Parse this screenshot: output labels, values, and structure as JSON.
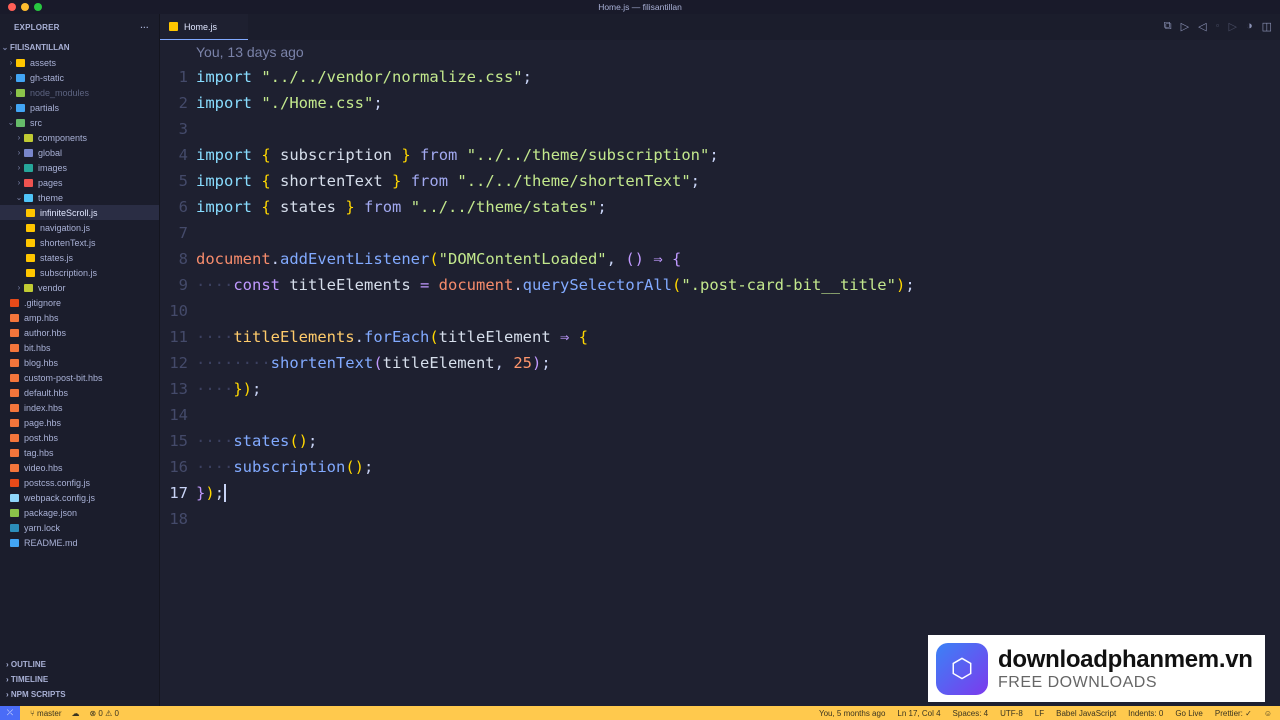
{
  "window": {
    "title": "Home.js — filisantillan"
  },
  "sidebar": {
    "title": "EXPLORER",
    "more": "···",
    "root": "FILISANTILLAN",
    "items": [
      {
        "label": "assets",
        "depth": 1,
        "type": "folder",
        "color": "#ffc600"
      },
      {
        "label": "gh-static",
        "depth": 1,
        "type": "folder",
        "color": "#42a5f5"
      },
      {
        "label": "node_modules",
        "depth": 1,
        "type": "folder",
        "color": "#8bc34a",
        "dim": true
      },
      {
        "label": "partials",
        "depth": 1,
        "type": "folder",
        "color": "#42a5f5"
      },
      {
        "label": "src",
        "depth": 1,
        "type": "folder-open",
        "color": "#66bb6a"
      },
      {
        "label": "components",
        "depth": 2,
        "type": "folder",
        "color": "#c0ca33"
      },
      {
        "label": "global",
        "depth": 2,
        "type": "folder",
        "color": "#7986cb"
      },
      {
        "label": "images",
        "depth": 2,
        "type": "folder",
        "color": "#26a69a"
      },
      {
        "label": "pages",
        "depth": 2,
        "type": "folder",
        "color": "#ef5350"
      },
      {
        "label": "theme",
        "depth": 2,
        "type": "folder-open",
        "color": "#4fc3f7"
      },
      {
        "label": "infiniteScroll.js",
        "depth": 3,
        "type": "file",
        "color": "#ffc600",
        "selected": true
      },
      {
        "label": "navigation.js",
        "depth": 3,
        "type": "file",
        "color": "#ffc600"
      },
      {
        "label": "shortenText.js",
        "depth": 3,
        "type": "file",
        "color": "#ffc600"
      },
      {
        "label": "states.js",
        "depth": 3,
        "type": "file",
        "color": "#ffc600"
      },
      {
        "label": "subscription.js",
        "depth": 3,
        "type": "file",
        "color": "#ffc600"
      },
      {
        "label": "vendor",
        "depth": 2,
        "type": "folder",
        "color": "#c0ca33"
      },
      {
        "label": ".gitignore",
        "depth": 1,
        "type": "file",
        "color": "#e64a19"
      },
      {
        "label": "amp.hbs",
        "depth": 1,
        "type": "file",
        "color": "#f4753b"
      },
      {
        "label": "author.hbs",
        "depth": 1,
        "type": "file",
        "color": "#f4753b"
      },
      {
        "label": "bit.hbs",
        "depth": 1,
        "type": "file",
        "color": "#f4753b"
      },
      {
        "label": "blog.hbs",
        "depth": 1,
        "type": "file",
        "color": "#f4753b"
      },
      {
        "label": "custom-post-bit.hbs",
        "depth": 1,
        "type": "file",
        "color": "#f4753b"
      },
      {
        "label": "default.hbs",
        "depth": 1,
        "type": "file",
        "color": "#f4753b"
      },
      {
        "label": "index.hbs",
        "depth": 1,
        "type": "file",
        "color": "#f4753b"
      },
      {
        "label": "page.hbs",
        "depth": 1,
        "type": "file",
        "color": "#f4753b"
      },
      {
        "label": "post.hbs",
        "depth": 1,
        "type": "file",
        "color": "#f4753b"
      },
      {
        "label": "tag.hbs",
        "depth": 1,
        "type": "file",
        "color": "#f4753b"
      },
      {
        "label": "video.hbs",
        "depth": 1,
        "type": "file",
        "color": "#f4753b"
      },
      {
        "label": "postcss.config.js",
        "depth": 1,
        "type": "file",
        "color": "#e64a19"
      },
      {
        "label": "webpack.config.js",
        "depth": 1,
        "type": "file",
        "color": "#8ed6fb"
      },
      {
        "label": "package.json",
        "depth": 1,
        "type": "file",
        "color": "#8bc34a"
      },
      {
        "label": "yarn.lock",
        "depth": 1,
        "type": "file",
        "color": "#2c8ebb"
      },
      {
        "label": "README.md",
        "depth": 1,
        "type": "file",
        "color": "#42a5f5"
      }
    ],
    "sections": [
      "OUTLINE",
      "TIMELINE",
      "NPM SCRIPTS"
    ]
  },
  "tab": {
    "label": "Home.js"
  },
  "editor": {
    "blame": "You, 13 days ago",
    "current_line": 17,
    "lines": [
      [
        [
          "kw",
          "import"
        ],
        [
          "pn",
          " "
        ],
        [
          "str",
          "\"../../vendor/normalize.css\""
        ],
        [
          "pn",
          ";"
        ]
      ],
      [
        [
          "kw",
          "import"
        ],
        [
          "pn",
          " "
        ],
        [
          "str",
          "\"./Home.css\""
        ],
        [
          "pn",
          ";"
        ]
      ],
      [],
      [
        [
          "kw",
          "import"
        ],
        [
          "pn",
          " "
        ],
        [
          "br",
          "{"
        ],
        [
          "id",
          " subscription "
        ],
        [
          "br",
          "}"
        ],
        [
          "pn",
          " "
        ],
        [
          "from",
          "from"
        ],
        [
          "pn",
          " "
        ],
        [
          "str",
          "\"../../theme/subscription\""
        ],
        [
          "pn",
          ";"
        ]
      ],
      [
        [
          "kw",
          "import"
        ],
        [
          "pn",
          " "
        ],
        [
          "br",
          "{"
        ],
        [
          "id",
          " shortenText "
        ],
        [
          "br",
          "}"
        ],
        [
          "pn",
          " "
        ],
        [
          "from",
          "from"
        ],
        [
          "pn",
          " "
        ],
        [
          "str",
          "\"../../theme/shortenText\""
        ],
        [
          "pn",
          ";"
        ]
      ],
      [
        [
          "kw",
          "import"
        ],
        [
          "pn",
          " "
        ],
        [
          "br",
          "{"
        ],
        [
          "id",
          " states "
        ],
        [
          "br",
          "}"
        ],
        [
          "pn",
          " "
        ],
        [
          "from",
          "from"
        ],
        [
          "pn",
          " "
        ],
        [
          "str",
          "\"../../theme/states\""
        ],
        [
          "pn",
          ";"
        ]
      ],
      [],
      [
        [
          "obj",
          "document"
        ],
        [
          "pn",
          "."
        ],
        [
          "fn",
          "addEventListener"
        ],
        [
          "br",
          "("
        ],
        [
          "str",
          "\"DOMContentLoaded\""
        ],
        [
          "pn",
          ", "
        ],
        [
          "br2",
          "()"
        ],
        [
          "pn",
          " "
        ],
        [
          "op",
          "⇒"
        ],
        [
          "pn",
          " "
        ],
        [
          "br2",
          "{"
        ]
      ],
      [
        [
          "ws",
          "····"
        ],
        [
          "const",
          "const"
        ],
        [
          "id",
          " titleElements "
        ],
        [
          "op",
          "="
        ],
        [
          "pn",
          " "
        ],
        [
          "obj",
          "document"
        ],
        [
          "pn",
          "."
        ],
        [
          "fn",
          "querySelectorAll"
        ],
        [
          "br",
          "("
        ],
        [
          "str",
          "\".post-card-bit__title\""
        ],
        [
          "br",
          ")"
        ],
        [
          "pn",
          ";"
        ]
      ],
      [],
      [
        [
          "ws",
          "····"
        ],
        [
          "var",
          "titleElements"
        ],
        [
          "pn",
          "."
        ],
        [
          "fn",
          "forEach"
        ],
        [
          "br",
          "("
        ],
        [
          "id",
          "titleElement"
        ],
        [
          "pn",
          " "
        ],
        [
          "op",
          "⇒"
        ],
        [
          "pn",
          " "
        ],
        [
          "br",
          "{"
        ]
      ],
      [
        [
          "ws",
          "········"
        ],
        [
          "fn",
          "shortenText"
        ],
        [
          "br2",
          "("
        ],
        [
          "id",
          "titleElement"
        ],
        [
          "pn",
          ", "
        ],
        [
          "num",
          "25"
        ],
        [
          "br2",
          ")"
        ],
        [
          "pn",
          ";"
        ]
      ],
      [
        [
          "ws",
          "····"
        ],
        [
          "br",
          "}"
        ],
        [
          "br",
          ")"
        ],
        [
          "pn",
          ";"
        ]
      ],
      [],
      [
        [
          "ws",
          "····"
        ],
        [
          "fn",
          "states"
        ],
        [
          "br",
          "()"
        ],
        [
          "pn",
          ";"
        ]
      ],
      [
        [
          "ws",
          "····"
        ],
        [
          "fn",
          "subscription"
        ],
        [
          "br",
          "()"
        ],
        [
          "pn",
          ";"
        ]
      ],
      [
        [
          "br2",
          "}"
        ],
        [
          "br",
          ")"
        ],
        [
          "pn",
          ";"
        ]
      ],
      []
    ]
  },
  "status": {
    "branch": "master",
    "errors": "0",
    "warnings": "0",
    "right": [
      "You, 5 months ago",
      "Ln 17, Col 4",
      "Spaces: 4",
      "UTF-8",
      "LF",
      "Babel JavaScript",
      "Indents: 0",
      "Go Live",
      "Prettier: ✓"
    ]
  },
  "watermark": {
    "title": "downloadphanmem.vn",
    "subtitle": "FREE DOWNLOADS"
  }
}
